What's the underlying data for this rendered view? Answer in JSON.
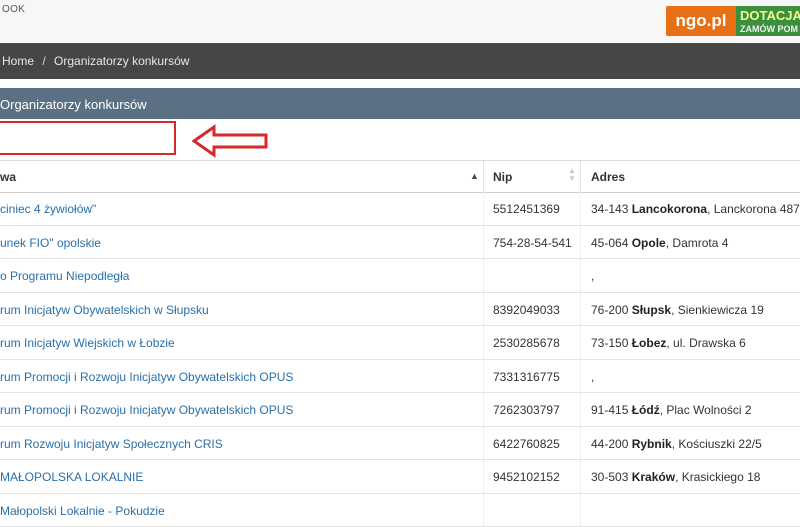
{
  "topbar": {
    "left_text": "OOK"
  },
  "badge": {
    "ngo": "ngo.pl",
    "line1": "DOTACJA",
    "line2": "ZAMÓW POM"
  },
  "breadcrumb": {
    "home": "Home",
    "separator": "/",
    "current": "Organizatorzy konkursów"
  },
  "section": {
    "title": "Organizatorzy konkursów"
  },
  "search": {
    "value": "",
    "placeholder": ""
  },
  "table": {
    "headers": {
      "name": "wa",
      "nip": "Nip",
      "adres": "Adres"
    },
    "rows": [
      {
        "name": "ciniec 4 żywiołów\"",
        "nip": "5512451369",
        "postal": "34-143",
        "city": "Lancokorona",
        "street": ", Lanckorona 487"
      },
      {
        "name": "unek FIO\" opolskie",
        "nip": "754-28-54-541",
        "postal": "45-064",
        "city": "Opole",
        "street": ", Damrota 4"
      },
      {
        "name": "o Programu Niepodległa",
        "nip": "",
        "postal": "",
        "city": "",
        "street": ","
      },
      {
        "name": "rum Inicjatyw Obywatelskich w Słupsku",
        "nip": "8392049033",
        "postal": "76-200",
        "city": "Słupsk",
        "street": ", Sienkiewicza 19"
      },
      {
        "name": "rum Inicjatyw Wiejskich w Łobzie",
        "nip": "2530285678",
        "postal": "73-150",
        "city": "Łobez",
        "street": ", ul. Drawska 6"
      },
      {
        "name": "rum Promocji i Rozwoju Inicjatyw Obywatelskich OPUS",
        "nip": "7331316775",
        "postal": "",
        "city": "",
        "street": ","
      },
      {
        "name": "rum Promocji i Rozwoju Inicjatyw Obywatelskich OPUS",
        "nip": "7262303797",
        "postal": "91-415",
        "city": "Łódź",
        "street": ", Plac Wolności 2"
      },
      {
        "name": "rum Rozwoju Inicjatyw Społecznych CRIS",
        "nip": "6422760825",
        "postal": "44-200",
        "city": "Rybnik",
        "street": ", Kościuszki 22/5"
      },
      {
        "name": "MAŁOPOLSKA LOKALNIE",
        "nip": "9452102152",
        "postal": "30-503",
        "city": "Kraków",
        "street": ", Krasickiego 18"
      },
      {
        "name": "Małopolski Lokalnie - Pokudzie",
        "nip": "",
        "postal": "",
        "city": "",
        "street": ""
      }
    ]
  },
  "colors": {
    "link": "#2a6faa",
    "header_bar": "#5b7183",
    "breadcrumb_bar": "#464646",
    "highlight": "#d42a2a",
    "ngo_orange": "#e76f14",
    "dotacje_green": "#3d8f3d"
  },
  "icons": {
    "annotation": "arrow-left-icon",
    "sort_asc": "sort-asc-icon",
    "sort_both": "sort-both-icon"
  }
}
